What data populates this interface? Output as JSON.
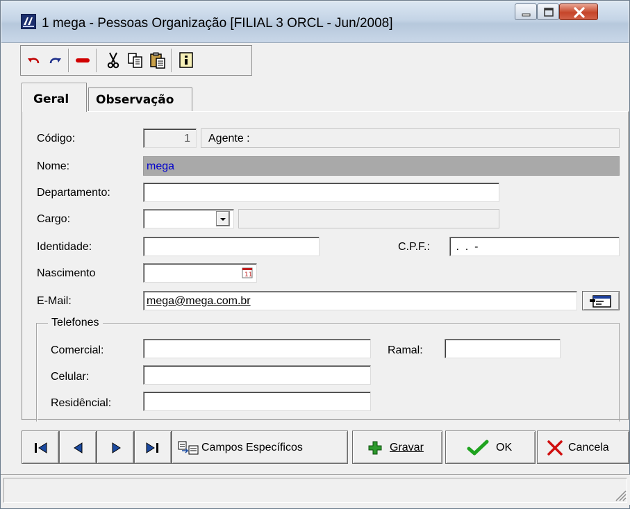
{
  "window": {
    "title": "1 mega -  Pessoas Organização [FILIAL 3 ORCL - Jun/2008]",
    "controls": [
      "minimize-icon",
      "maximize-icon",
      "close-icon"
    ]
  },
  "toolbar": {
    "icons": [
      "undo-icon",
      "redo-icon",
      "delete-icon",
      "cut-icon",
      "copy-icon",
      "paste-icon",
      "info-icon"
    ]
  },
  "tabs": [
    {
      "label": "Geral",
      "active": true
    },
    {
      "label": "Observação",
      "active": false
    }
  ],
  "form": {
    "codigo": {
      "label": "Código:",
      "value": "1"
    },
    "agente": {
      "label": "Agente :"
    },
    "nome": {
      "label": "Nome:",
      "value": "mega"
    },
    "departamento": {
      "label": "Departamento:",
      "value": ""
    },
    "cargo": {
      "label": "Cargo:",
      "value": ""
    },
    "identidade": {
      "label": "Identidade:",
      "value": ""
    },
    "cpf": {
      "label": "C.P.F.:",
      "value": " .  .  -"
    },
    "nascimento": {
      "label": "Nascimento",
      "value": ""
    },
    "email": {
      "label": "E-Mail:",
      "value": "mega@mega.com.br"
    }
  },
  "telefones": {
    "legend": "Telefones",
    "comercial": {
      "label": "Comercial:",
      "value": ""
    },
    "ramal": {
      "label": "Ramal:",
      "value": ""
    },
    "celular": {
      "label": "Celular:",
      "value": ""
    },
    "residencial": {
      "label": "Residêncial:",
      "value": ""
    }
  },
  "buttons": {
    "campos_especificos": "Campos Específicos",
    "gravar": "Gravar",
    "ok": "OK",
    "cancela": "Cancela"
  },
  "colors": {
    "accent_text": "#0000cc",
    "ok_green": "#1fa31f",
    "cancel_red": "#d01010",
    "gravar_green": "#2e9a2e"
  }
}
